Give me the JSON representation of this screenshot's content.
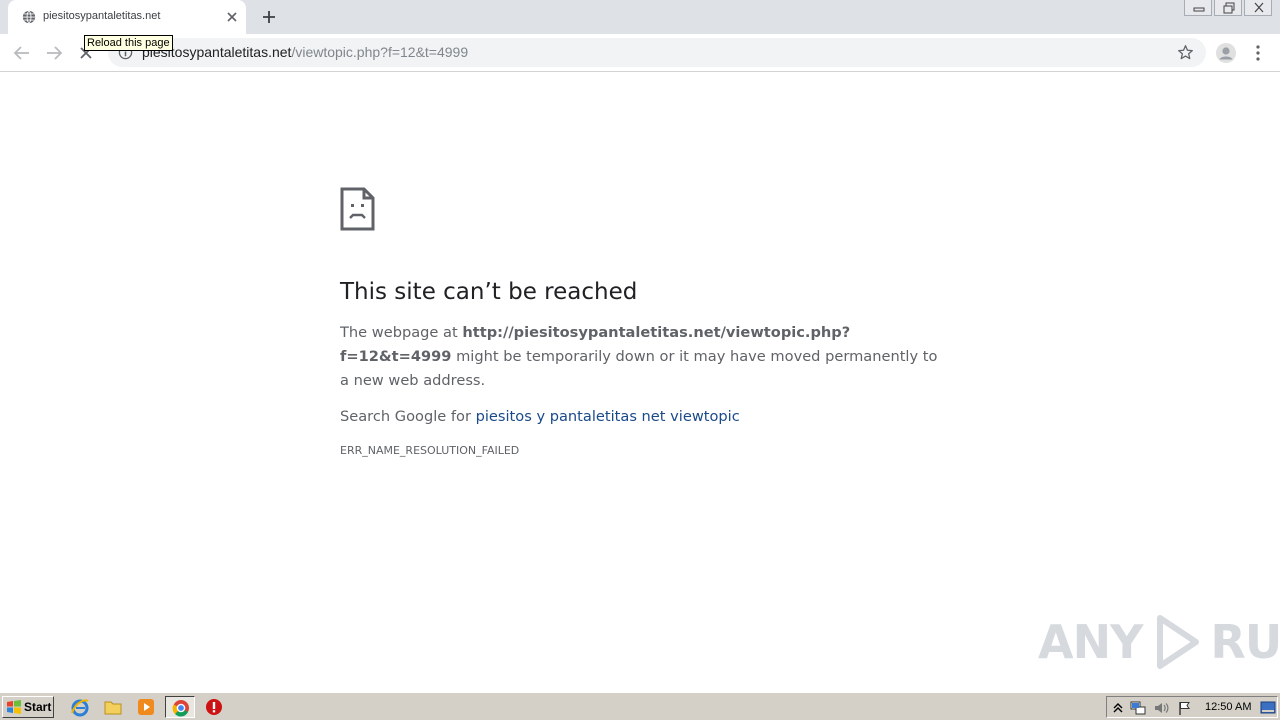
{
  "browser": {
    "tab": {
      "title": "piesitosypantaletitas.net",
      "favicon": "globe-icon"
    },
    "tooltip": "Reload this page",
    "address": {
      "host": "piesitosypantaletitas.net",
      "path": "/viewtopic.php?f=12&t=4999"
    }
  },
  "error_page": {
    "icon": "sad-page-icon",
    "title": "This site can’t be reached",
    "desc_prefix": "The webpage at ",
    "desc_url": "http://piesitosypantaletitas.net/viewtopic.php?f=12&t=4999",
    "desc_suffix": " might be temporarily down or it may have moved permanently to a new web address.",
    "search_prefix": "Search Google for ",
    "search_link": "piesitos y pantaletitas net viewtopic",
    "error_code": "ERR_NAME_RESOLUTION_FAILED"
  },
  "watermark": {
    "left": "ANY",
    "right": "RUN"
  },
  "taskbar": {
    "start_label": "Start",
    "clock": "12:50 AM"
  },
  "colors": {
    "tabstrip": "#dee1e6",
    "omnibox": "#f1f3f4",
    "link": "#1a4a8a",
    "taskbar": "#d4d0c8"
  }
}
